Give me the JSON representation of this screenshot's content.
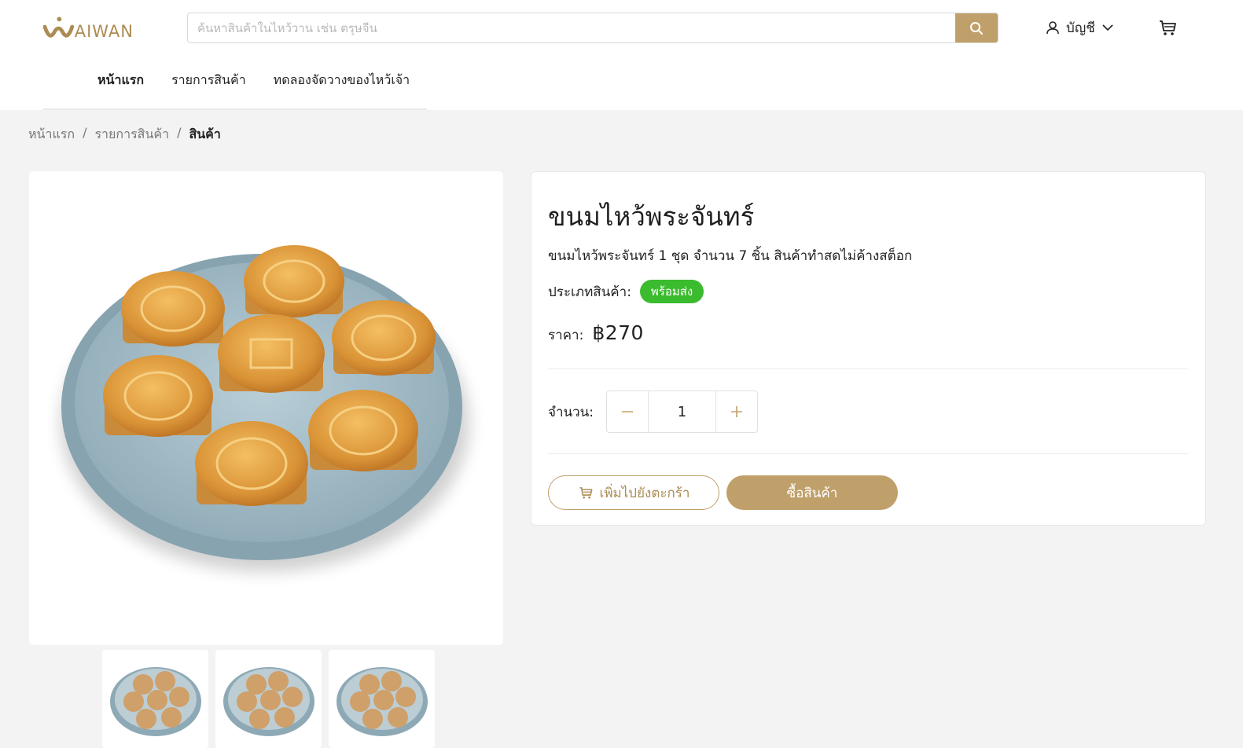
{
  "brand": {
    "logo_text": "AIWAN",
    "accent_color": "#c0a06a"
  },
  "search": {
    "placeholder": "ค้นหาสินค้าในไหว้วาน เช่น ตรุษจีน",
    "value": "",
    "icon": "search-icon"
  },
  "account": {
    "label": "บัญชี",
    "icon": "user-icon"
  },
  "cart_icon": "cart-icon",
  "nav": {
    "items": [
      {
        "label": "หน้าแรก",
        "active": true
      },
      {
        "label": "รายการสินค้า",
        "active": false
      },
      {
        "label": "ทดลองจัดวางของไหว้เจ้า",
        "active": false
      }
    ]
  },
  "breadcrumb": {
    "items": [
      "หน้าแรก",
      "รายการสินค้า"
    ],
    "separator": "/",
    "current": "สินค้า"
  },
  "product": {
    "title": "ขนมไหว้พระจันทร์",
    "description": "ขนมไหว้พระจันทร์ 1 ชุด จำนวน 7 ชิ้น สินค้าทำสดไม่ค้างสต็อก",
    "type_label": "ประเภทสินค้า:",
    "type_value": "พร้อมส่ง",
    "type_color": "#3bbb2e",
    "price_label": "ราคา:",
    "price": "฿270",
    "quantity_label": "จำนวน:",
    "quantity": "1",
    "add_to_cart_label": "เพิ่มไปยังตะกร้า",
    "buy_label": "ซื้อสินค้า",
    "thumbnail_count": 3
  }
}
